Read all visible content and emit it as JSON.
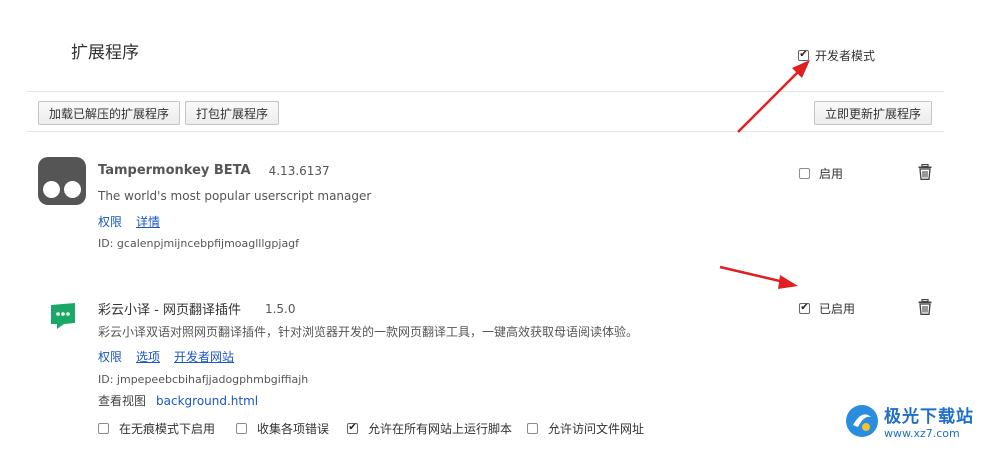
{
  "page": {
    "title": "扩展程序",
    "developer_mode_label": "开发者模式",
    "developer_mode_checked": true
  },
  "toolbar": {
    "load_unpacked": "加载已解压的扩展程序",
    "pack_extension": "打包扩展程序",
    "update_now": "立即更新扩展程序"
  },
  "extensions": [
    {
      "name": "Tampermonkey BETA",
      "version": "4.13.6137",
      "description": "The world's most popular userscript manager",
      "links": [
        "权限",
        "详情"
      ],
      "id_text": "ID: gcalenpjmijncebpfijmoaglllgpjagf",
      "enable_label": "启用",
      "enabled": false,
      "icon": "tampermonkey-icon"
    },
    {
      "name": "彩云小译 - 网页翻译插件",
      "version": "1.5.0",
      "description": "彩云小译双语对照网页翻译插件，针对浏览器开发的一款网页翻译工具，一键高效获取母语阅读体验。",
      "links": [
        "权限",
        "选项",
        "开发者网站"
      ],
      "id_text": "ID: jmpepeebcbihafjjadogphmbgiffiajh",
      "inspect_label": "查看视图",
      "inspect_link": "background.html",
      "enable_label": "已启用",
      "enabled": true,
      "icon": "caiyun-icon",
      "options": [
        {
          "label": "在无痕模式下启用",
          "checked": false
        },
        {
          "label": "收集各项错误",
          "checked": false
        },
        {
          "label": "允许在所有网站上运行脚本",
          "checked": true
        },
        {
          "label": "允许访问文件网址",
          "checked": false
        }
      ]
    }
  ],
  "watermark": {
    "brand": "极光下载站",
    "url": "www.xz7.com"
  },
  "colors": {
    "link": "#1a56c8",
    "arrow": "#e02020",
    "caiyun_green": "#1aa866"
  }
}
